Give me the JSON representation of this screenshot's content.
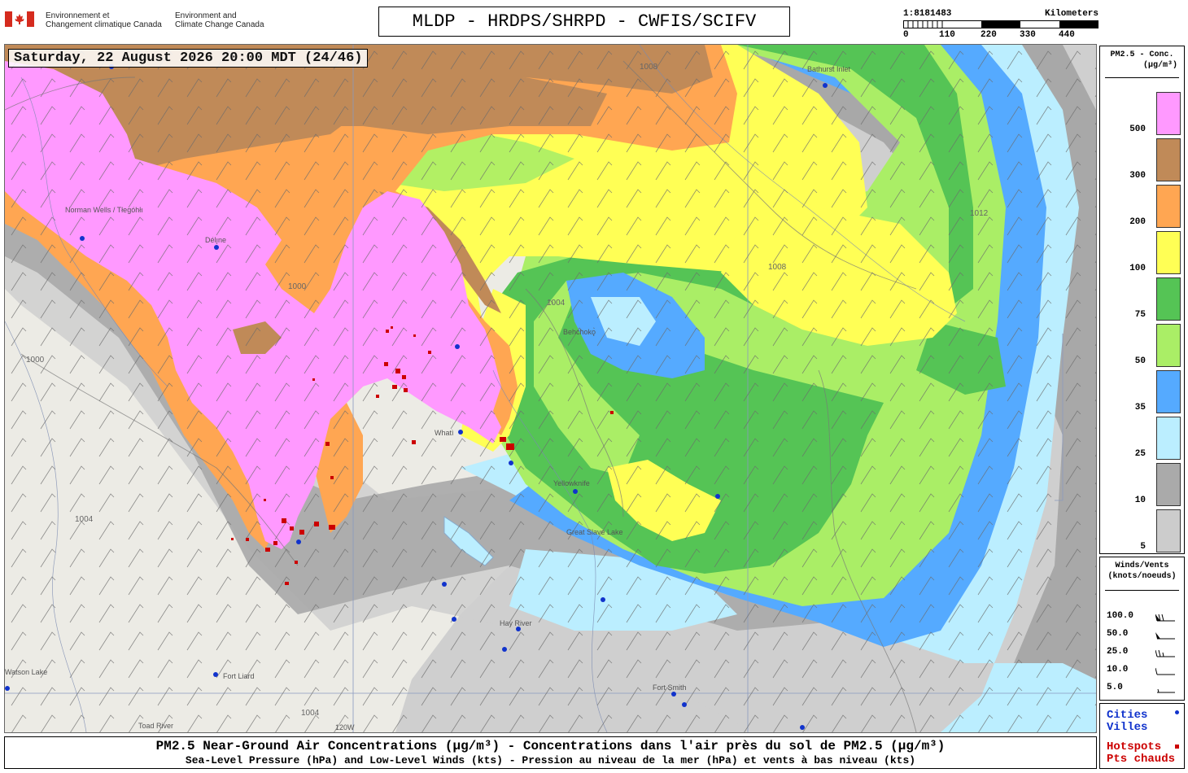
{
  "header": {
    "org_fr_1": "Environnement et",
    "org_fr_2": "Changement climatique Canada",
    "org_en_1": "Environment and",
    "org_en_2": "Climate Change Canada",
    "title": "MLDP - HRDPS/SHRPD - CWFIS/SCIFV"
  },
  "scale": {
    "ratio": "1:8181483",
    "unit": "Kilometers",
    "ticks": [
      "0",
      "110",
      "220",
      "330",
      "440"
    ]
  },
  "map": {
    "datetime": "Saturday, 22 August 2026 20:00 MDT (24/46)",
    "places": [
      "Norman Wells / Tłegóhłı",
      "Délı̨ne",
      "Bathurst Inlet",
      "Behchokǫ̀",
      "Whatì",
      "Yellowknife",
      "Hay River",
      "Fort Liard",
      "Fort Smith",
      "Toad River",
      "Great Slave Lake",
      "Watson Lake"
    ],
    "isobar_labels": [
      "1000",
      "1008",
      "1004",
      "1012"
    ],
    "longitude_label": "120W"
  },
  "legend": {
    "title_1": "PM2.5 - Conc.",
    "title_2": "(µg/m³)",
    "bins": [
      {
        "label": "500",
        "color": "#ff99ff"
      },
      {
        "label": "300",
        "color": "#c08a58"
      },
      {
        "label": "200",
        "color": "#ffa652"
      },
      {
        "label": "100",
        "color": "#ffff55"
      },
      {
        "label": "75",
        "color": "#55c455"
      },
      {
        "label": "50",
        "color": "#aaee66"
      },
      {
        "label": "35",
        "color": "#55aaff"
      },
      {
        "label": "25",
        "color": "#bbeeff"
      },
      {
        "label": "10",
        "color": "#aaaaaa"
      },
      {
        "label": "5",
        "color": "#cccccc"
      }
    ]
  },
  "winds": {
    "title_1": "Winds/Vents",
    "title_2": "(knots/noeuds)",
    "rows": [
      "100.0",
      "50.0",
      "25.0",
      "10.0",
      "5.0"
    ]
  },
  "cities_legend": {
    "cities": "Cities",
    "villes": "Villes",
    "city_color": "#1133cc",
    "hotspots": "Hotspots",
    "pts": "Pts chauds",
    "hotspot_color": "#cc0000"
  },
  "footer": {
    "line1": "PM2.5 Near-Ground Air Concentrations (µg/m³) - Concentrations dans l'air près du sol de PM2.5 (µg/m³)",
    "line2": "Sea-Level Pressure (hPa) and Low-Level Winds (kts) - Pression au niveau de la mer (hPa) et vents à bas niveau (kts)"
  }
}
